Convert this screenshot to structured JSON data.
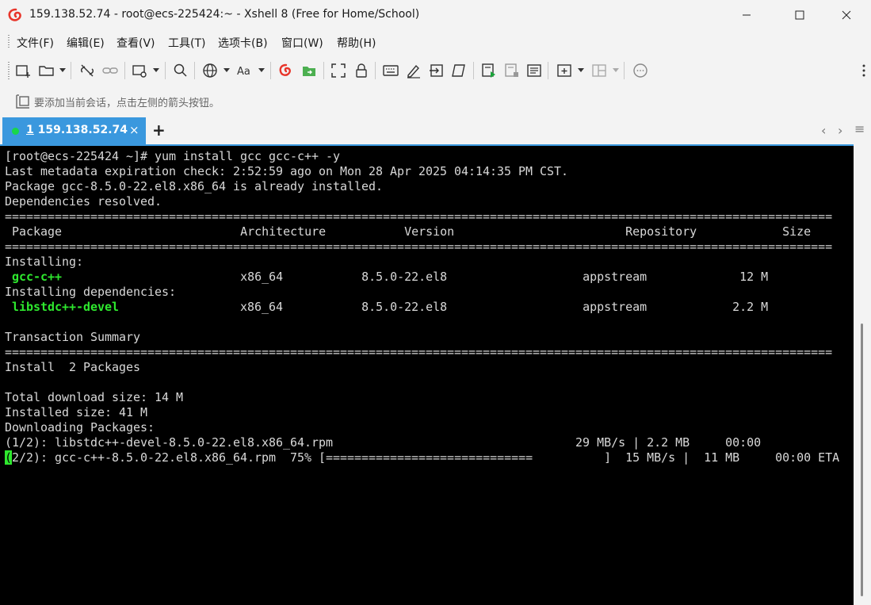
{
  "window": {
    "title": "159.138.52.74 - root@ecs-225424:~ - Xshell 8 (Free for Home/School)"
  },
  "menu": [
    "文件(F)",
    "编辑(E)",
    "查看(V)",
    "工具(T)",
    "选项卡(B)",
    "窗口(W)",
    "帮助(H)"
  ],
  "address_bar": {
    "hint": "要添加当前会话，点击左侧的箭头按钮。"
  },
  "tabs": {
    "active_number": "1",
    "active_label": "159.138.52.74",
    "close_glyph": "×",
    "add_glyph": "+"
  },
  "terminal": {
    "prompt": "[root@ecs-225424 ~]# yum install gcc gcc-c++ -y",
    "meta_line": "Last metadata expiration check: 2:52:59 ago on Mon 28 Apr 2025 04:14:35 PM CST.",
    "installed_line": "Package gcc-8.5.0-22.el8.x86_64 is already installed.",
    "resolved_line": "Dependencies resolved.",
    "separator": "====================================================================================================================",
    "header": {
      "package": "Package",
      "arch": "Architecture",
      "version": "Version",
      "repo": "Repository",
      "size": "Size"
    },
    "installing_label": "Installing:",
    "deps_label": "Installing dependencies:",
    "packages": [
      {
        "name": "gcc-c++",
        "arch": "x86_64",
        "version": "8.5.0-22.el8",
        "repo": "appstream",
        "size": "12 M"
      },
      {
        "name": "libstdc++-devel",
        "arch": "x86_64",
        "version": "8.5.0-22.el8",
        "repo": "appstream",
        "size": "2.2 M"
      }
    ],
    "summary_label": "Transaction Summary",
    "install_count": "Install  2 Packages",
    "total_download": "Total download size: 14 M",
    "installed_size": "Installed size: 41 M",
    "downloading": "Downloading Packages:",
    "dl1": "(1/2): libstdc++-devel-8.5.0-22.el8.x86_64.rpm                                  29 MB/s | 2.2 MB     00:00",
    "dl2_cursor": "(",
    "dl2": "2/2): gcc-c++-8.5.0-22.el8.x86_64.rpm  75% [=============================          ]  15 MB/s |  11 MB     00:00 ETA"
  }
}
